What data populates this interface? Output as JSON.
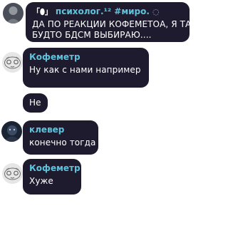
{
  "messages": [
    {
      "author_prefix": "「⬮」",
      "author": "психолог.¹² #миро.",
      "author_suffix": "◌",
      "lines": [
        "ДА ПО РЕАКЦИИ КОФЕМЕТОА, Я ТАМ",
        "БУДТО БДСМ ВЫБИРАЮ...."
      ]
    },
    {
      "author": "Кофеметр",
      "lines": [
        "Ну как с нами например"
      ]
    },
    {
      "lines": [
        "Не"
      ]
    },
    {
      "author": "клевер",
      "lines": [
        "конечно тогда"
      ]
    },
    {
      "author": "Кофеметр",
      "lines": [
        "Хуже"
      ]
    }
  ],
  "colors": {
    "bubble": "#1f1b2e",
    "author_name": "#5fc3dc",
    "text": "#ffffff",
    "background": "#ffffff"
  }
}
